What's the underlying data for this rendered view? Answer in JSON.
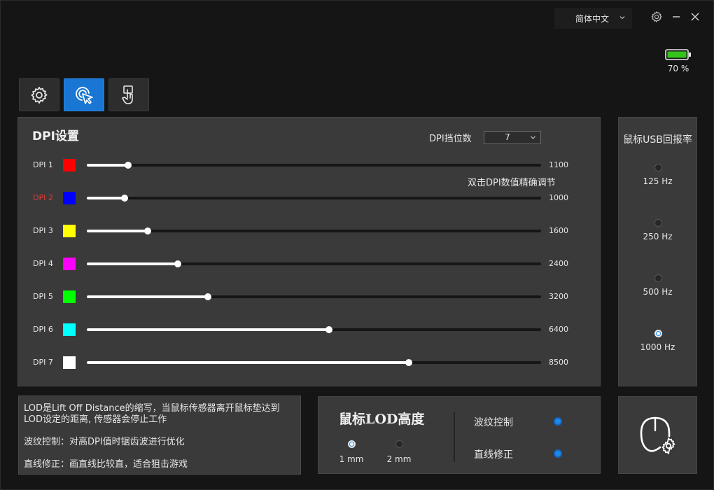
{
  "header": {
    "language": "简体中文",
    "battery_percent": 70,
    "battery_text": "70 %"
  },
  "tabs": [
    {
      "name": "settings",
      "icon": "gear-icon",
      "active": false
    },
    {
      "name": "dpi",
      "icon": "cursor-click-icon",
      "active": true
    },
    {
      "name": "macro",
      "icon": "touch-hand-icon",
      "active": false
    }
  ],
  "dpi": {
    "title": "DPI设置",
    "count_label": "DPI挡位数",
    "count_value": "7",
    "hint": "双击DPI数值精确调节",
    "max": 12000,
    "selected_index": 1,
    "levels": [
      {
        "label": "DPI 1",
        "color": "#ff0000",
        "value": 1100
      },
      {
        "label": "DPI 2",
        "color": "#0000ff",
        "value": 1000
      },
      {
        "label": "DPI 3",
        "color": "#ffff00",
        "value": 1600
      },
      {
        "label": "DPI 4",
        "color": "#ff00ff",
        "value": 2400
      },
      {
        "label": "DPI 5",
        "color": "#00ff00",
        "value": 3200
      },
      {
        "label": "DPI 6",
        "color": "#00ffff",
        "value": 6400
      },
      {
        "label": "DPI 7",
        "color": "#ffffff",
        "value": 8500
      }
    ]
  },
  "usb": {
    "title": "鼠标USB回报率",
    "options": [
      "125 Hz",
      "250 Hz",
      "500 Hz",
      "1000 Hz"
    ],
    "selected": "1000 Hz"
  },
  "description": {
    "lod_line1": "LOD是Lift Off Distance的缩写，当鼠标传感器离开鼠标垫达到",
    "lod_line2": "LOD设定的距离, 传感器会停止工作",
    "ripple": "波纹控制：对高DPI值时锯齿波进行优化",
    "angle": "直线修正：画直线比较直，适合狙击游戏"
  },
  "lod": {
    "title": "鼠标LOD高度",
    "options": [
      "1 mm",
      "2 mm"
    ],
    "selected": "1 mm",
    "ripple_label": "波纹控制",
    "ripple_on": true,
    "angle_label": "直线修正",
    "angle_on": true
  }
}
